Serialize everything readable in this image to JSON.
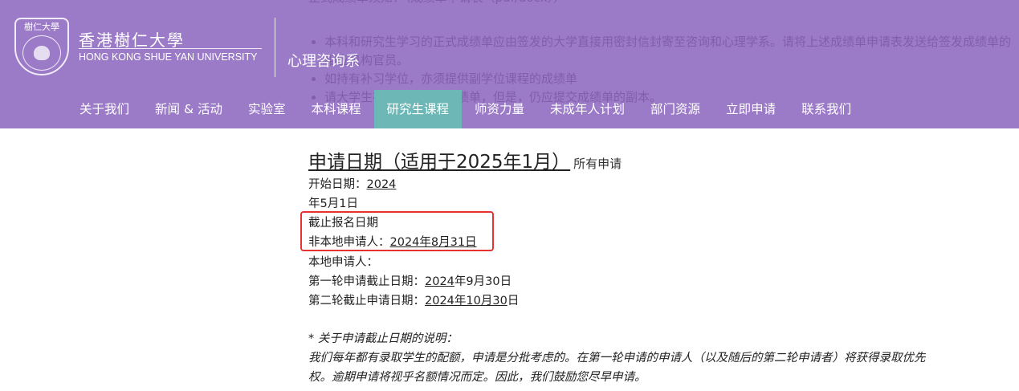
{
  "header": {
    "bg_text": {
      "line0": "正式成绩单须知：（成绩单申请表（pdf/docx））",
      "bullets": [
        "本科和研究生学习的正式成绩单应由签发的大学直接用密封信封寄至咨询和心理学系。请将上述成绩单申请表发送给签发成绩单的相应机构官员。",
        "如持有补习学位，亦须提供副学位课程的成绩单",
        "请大学生在毕业后索取成绩单，但是，仍应提交成绩单的副本。"
      ]
    },
    "logo": {
      "seal_text": "樹仁大學",
      "name_cn": "香港樹仁大學",
      "name_en": "HONG KONG SHUE YAN UNIVERSITY"
    },
    "dept_name": "心理咨询系"
  },
  "nav": {
    "items": [
      {
        "label": "关于我们"
      },
      {
        "label": "新闻 & 活动"
      },
      {
        "label": "实验室"
      },
      {
        "label": "本科课程"
      },
      {
        "label": "研究生课程"
      },
      {
        "label": "师资力量"
      },
      {
        "label": "未成年人计划"
      },
      {
        "label": "部门资源"
      },
      {
        "label": "立即申请"
      },
      {
        "label": "联系我们"
      }
    ],
    "active": "研究生课程"
  },
  "main": {
    "title": "申请日期（适用于2025年1月）",
    "title_suffix": "所有申请",
    "start_label": "开始日期：",
    "start_link": "2024",
    "start_rest": "年5月1日",
    "deadline_label": "截止报名日期",
    "nonlocal_label": "非本地申请人：",
    "nonlocal_date": "2024年8月31日",
    "local_label": "本地申请人：",
    "round1_label": "第一轮申请截止日期：",
    "round1_link": "2024",
    "round1_rest": "年9月30日",
    "round2_label": "第二轮截止申请日期：",
    "round2_link": "2024年10月30",
    "round2_rest": "日",
    "note_title": "* 关于申请截止日期的说明：",
    "note_line1": "我们每年都有录取学生的配额，申请是分批考虑的。在第一轮申请的申请人（以及随后的第二轮申请者）将获得录取优先",
    "note_line2": "权。逾期申请将视乎名额情况而定。因此，我们鼓励您尽早申请。"
  },
  "colors": {
    "header_bg": "#9b7ac7",
    "nav_active_bg": "#6db8b6",
    "highlight": "#e53333"
  }
}
